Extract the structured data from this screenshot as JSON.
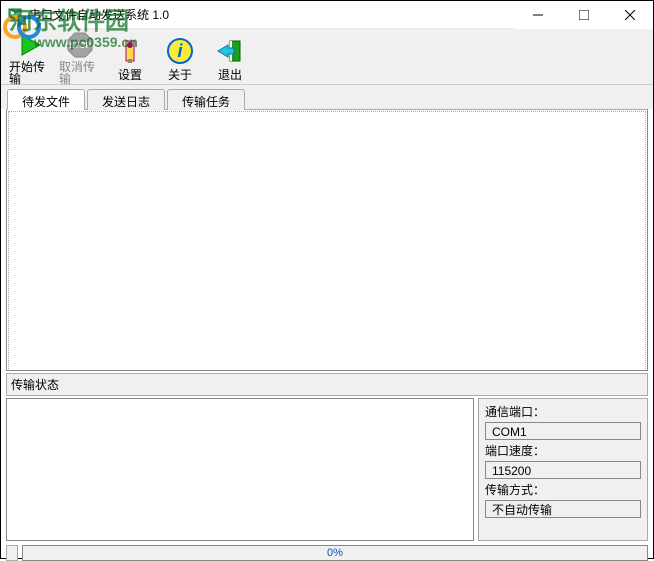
{
  "window": {
    "title": "串口文件自动发送系统 1.0"
  },
  "watermark": {
    "line1": "河东软件园",
    "line2": "www.pc0359.cn"
  },
  "toolbar": {
    "start": "开始传输",
    "cancel": "取消传输",
    "settings": "设置",
    "about": "关于",
    "exit": "退出"
  },
  "tabs": {
    "pending": "待发文件",
    "log": "发送日志",
    "tasks": "传输任务"
  },
  "status": {
    "header": "传输状态",
    "port_label": "通信端口：",
    "port_value": "COM1",
    "speed_label": "端口速度：",
    "speed_value": "115200",
    "mode_label": "传输方式：",
    "mode_value": "不自动传输"
  },
  "progress": {
    "percent": "0%"
  }
}
